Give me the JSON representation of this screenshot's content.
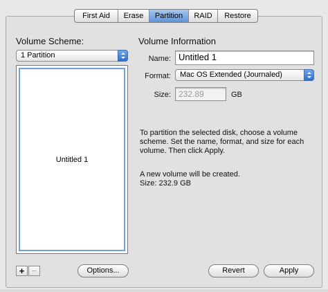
{
  "tabs": [
    {
      "label": "First Aid"
    },
    {
      "label": "Erase"
    },
    {
      "label": "Partition"
    },
    {
      "label": "RAID"
    },
    {
      "label": "Restore"
    }
  ],
  "active_tab": "Partition",
  "volume_scheme": {
    "heading": "Volume Scheme:",
    "popup_value": "1 Partition",
    "partition_label": "Untitled 1",
    "add_label": "+",
    "remove_label": "−",
    "options_label": "Options..."
  },
  "volume_info": {
    "heading": "Volume Information",
    "name_label": "Name:",
    "name_value": "Untitled 1",
    "format_label": "Format:",
    "format_value": "Mac OS Extended (Journaled)",
    "size_label": "Size:",
    "size_value": "232.89",
    "size_unit": "GB",
    "instructions": "To partition the selected disk, choose a volume scheme. Set the name, format, and size for each volume. Then click Apply.",
    "status_line1": "A new volume will be created.",
    "status_line2": "Size: 232.9 GB"
  },
  "buttons": {
    "revert": "Revert",
    "apply": "Apply"
  }
}
